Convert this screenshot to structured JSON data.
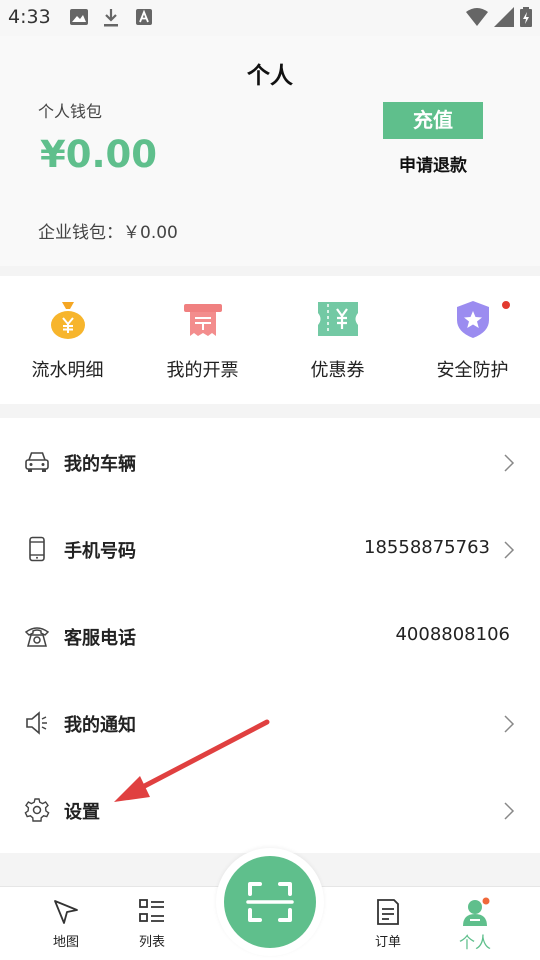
{
  "status_bar": {
    "time": "4:33"
  },
  "header": {
    "title": "个人",
    "wallet_label": "个人钱包",
    "wallet_amount": "¥0.00",
    "recharge_label": "充值",
    "refund_label": "申请退款",
    "corp_wallet": "企业钱包：￥0.00"
  },
  "quick_actions": [
    {
      "label": "流水明细",
      "icon": "money-bag-icon"
    },
    {
      "label": "我的开票",
      "icon": "receipt-icon"
    },
    {
      "label": "优惠券",
      "icon": "coupon-icon"
    },
    {
      "label": "安全防护",
      "icon": "shield-star-icon"
    }
  ],
  "menu": [
    {
      "label": "我的车辆",
      "value": "",
      "icon": "car-icon"
    },
    {
      "label": "手机号码",
      "value": "18558875763",
      "icon": "phone-icon"
    },
    {
      "label": "客服电话",
      "value": "4008808106",
      "icon": "telephone-icon"
    },
    {
      "label": "我的通知",
      "value": "",
      "icon": "speaker-icon"
    },
    {
      "label": "设置",
      "value": "",
      "icon": "gear-icon"
    }
  ],
  "tabbar": {
    "map": "地图",
    "list": "列表",
    "orders": "订单",
    "profile": "个人"
  },
  "colors": {
    "accent": "#5fbf8c",
    "alert": "#e23a2f",
    "annotation_arrow": "#e04040"
  }
}
